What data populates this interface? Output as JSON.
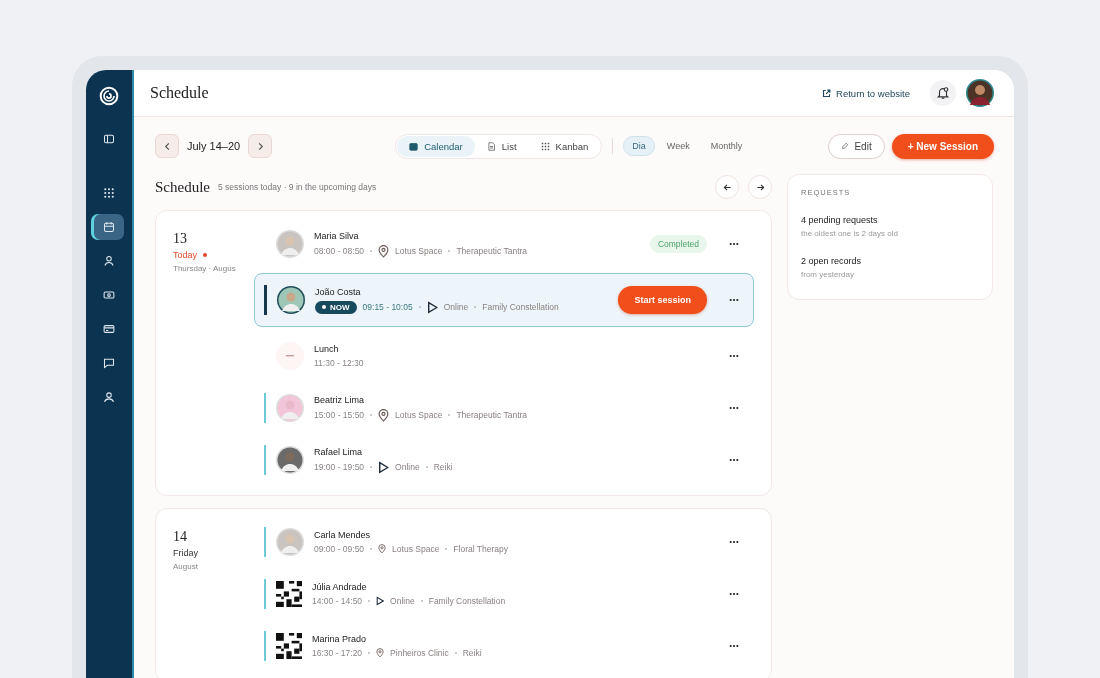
{
  "header": {
    "title": "Schedule",
    "return_link": "Return to website"
  },
  "sidebar": {
    "items": [
      {
        "kind": "panel",
        "selected": false
      },
      {
        "kind": "grid",
        "selected": false
      },
      {
        "kind": "calendar",
        "selected": true
      },
      {
        "kind": "user",
        "selected": false
      },
      {
        "kind": "money",
        "selected": false
      },
      {
        "kind": "card",
        "selected": false
      },
      {
        "kind": "chat",
        "selected": false
      },
      {
        "kind": "profile",
        "selected": false
      }
    ]
  },
  "toolbar": {
    "date_range": "July 14–20",
    "views": [
      {
        "kind": "calendar",
        "label": "Calendar",
        "selected": true
      },
      {
        "kind": "list",
        "label": "List",
        "selected": false
      },
      {
        "kind": "kanban",
        "label": "Kanban",
        "selected": false
      }
    ],
    "periods": [
      {
        "label": "Dia",
        "selected": true
      },
      {
        "label": "Week",
        "selected": false
      },
      {
        "label": "Monthly",
        "selected": false
      }
    ],
    "edit_button": "Edit",
    "new_button": "+ New Session"
  },
  "schedule": {
    "title": "Schedule",
    "subtitle": "5 sessions today · 9 in the upcoming days"
  },
  "days": [
    {
      "day": "13",
      "label": "Today",
      "today": true,
      "sub": "Thursday · Augus",
      "sessions": [
        {
          "kind": "session",
          "name": "Maria Silva",
          "time": "08:00 - 08:50",
          "place": {
            "kind": "venue",
            "label": "Lotus Space"
          },
          "therapy": "Therapeutic Tantra",
          "bar": false,
          "current": false,
          "status": "Completed"
        },
        {
          "kind": "session",
          "name": "João Costa",
          "badge": "NOW",
          "time": "09:15 - 10:05",
          "place": {
            "kind": "online",
            "label": "Online"
          },
          "therapy": "Family Constellation",
          "bar": true,
          "current": true,
          "action": "Start session"
        },
        {
          "kind": "break",
          "name": "Lunch",
          "time": "11:30 - 12:30"
        },
        {
          "kind": "session",
          "name": "Beatriz Lima",
          "time": "15:00 - 15:50",
          "place": {
            "kind": "venue",
            "label": "Lotus Space"
          },
          "therapy": "Therapeutic Tantra",
          "bar": true,
          "current": false
        },
        {
          "kind": "session",
          "name": "Rafael Lima",
          "time": "19:00 - 19:50",
          "place": {
            "kind": "online",
            "label": "Online"
          },
          "therapy": "Reiki",
          "bar": true,
          "current": false
        }
      ]
    },
    {
      "day": "14",
      "label": "Friday",
      "today": false,
      "sub": "August",
      "sessions": [
        {
          "kind": "session",
          "name": "Carla Mendes",
          "time": "09:00 - 09:50",
          "place": {
            "kind": "venue",
            "label": "Lotus Space"
          },
          "therapy": "Floral Therapy",
          "bar": true,
          "current": false
        },
        {
          "kind": "session",
          "avatar": {
            "kind": "code"
          },
          "name": "Júlia Andrade",
          "time": "14:00 - 14:50",
          "place": {
            "kind": "online",
            "label": "Online"
          },
          "therapy": "Family Constellation",
          "bar": true,
          "current": false
        },
        {
          "kind": "session",
          "avatar": {
            "kind": "code"
          },
          "name": "Marina Prado",
          "time": "16:30 - 17:20",
          "place": {
            "kind": "venue",
            "label": "Pinheiros Clinic"
          },
          "therapy": "Reiki",
          "bar": true,
          "current": false
        }
      ]
    }
  ],
  "requests": {
    "title": "REQUESTS",
    "items": [
      {
        "title": "4 pending requests",
        "sub": "the oldest one is 2 days old"
      },
      {
        "title": "2 open records",
        "sub": "from yesterday"
      }
    ]
  }
}
